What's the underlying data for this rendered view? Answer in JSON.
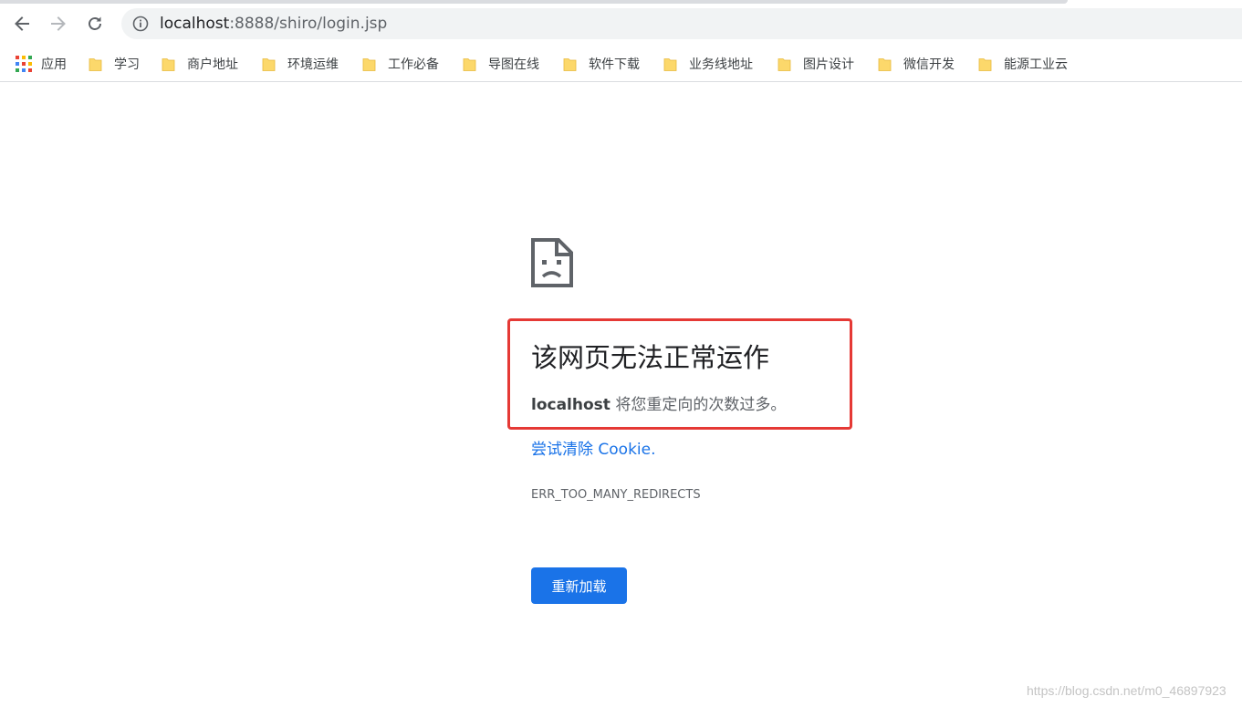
{
  "browser": {
    "url_host": "localhost",
    "url_rest": ":8888/shiro/login.jsp",
    "icons": {
      "back": "arrow-left-icon",
      "forward": "arrow-right-icon",
      "reload": "reload-icon",
      "site_info": "info-icon"
    }
  },
  "bookmarks": {
    "apps_label": "应用",
    "items": [
      {
        "label": "学习"
      },
      {
        "label": "商户地址"
      },
      {
        "label": "环境运维"
      },
      {
        "label": "工作必备"
      },
      {
        "label": "导图在线"
      },
      {
        "label": "软件下载"
      },
      {
        "label": "业务线地址"
      },
      {
        "label": "图片设计"
      },
      {
        "label": "微信开发"
      },
      {
        "label": "能源工业云"
      }
    ],
    "folder_color": "#fcd86b"
  },
  "error_page": {
    "title": "该网页无法正常运作",
    "desc_host": "localhost",
    "desc_text": " 将您重定向的次数过多。",
    "link_text": "尝试清除 Cookie.",
    "error_code": "ERR_TOO_MANY_REDIRECTS",
    "reload_label": "重新加载",
    "icon": "sad-page-icon"
  },
  "annotation": {
    "highlight_color": "#e53935"
  },
  "watermark": "https://blog.csdn.net/m0_46897923",
  "colors": {
    "accent": "#1a73e8",
    "text_primary": "#202124",
    "text_secondary": "#5f6368"
  }
}
